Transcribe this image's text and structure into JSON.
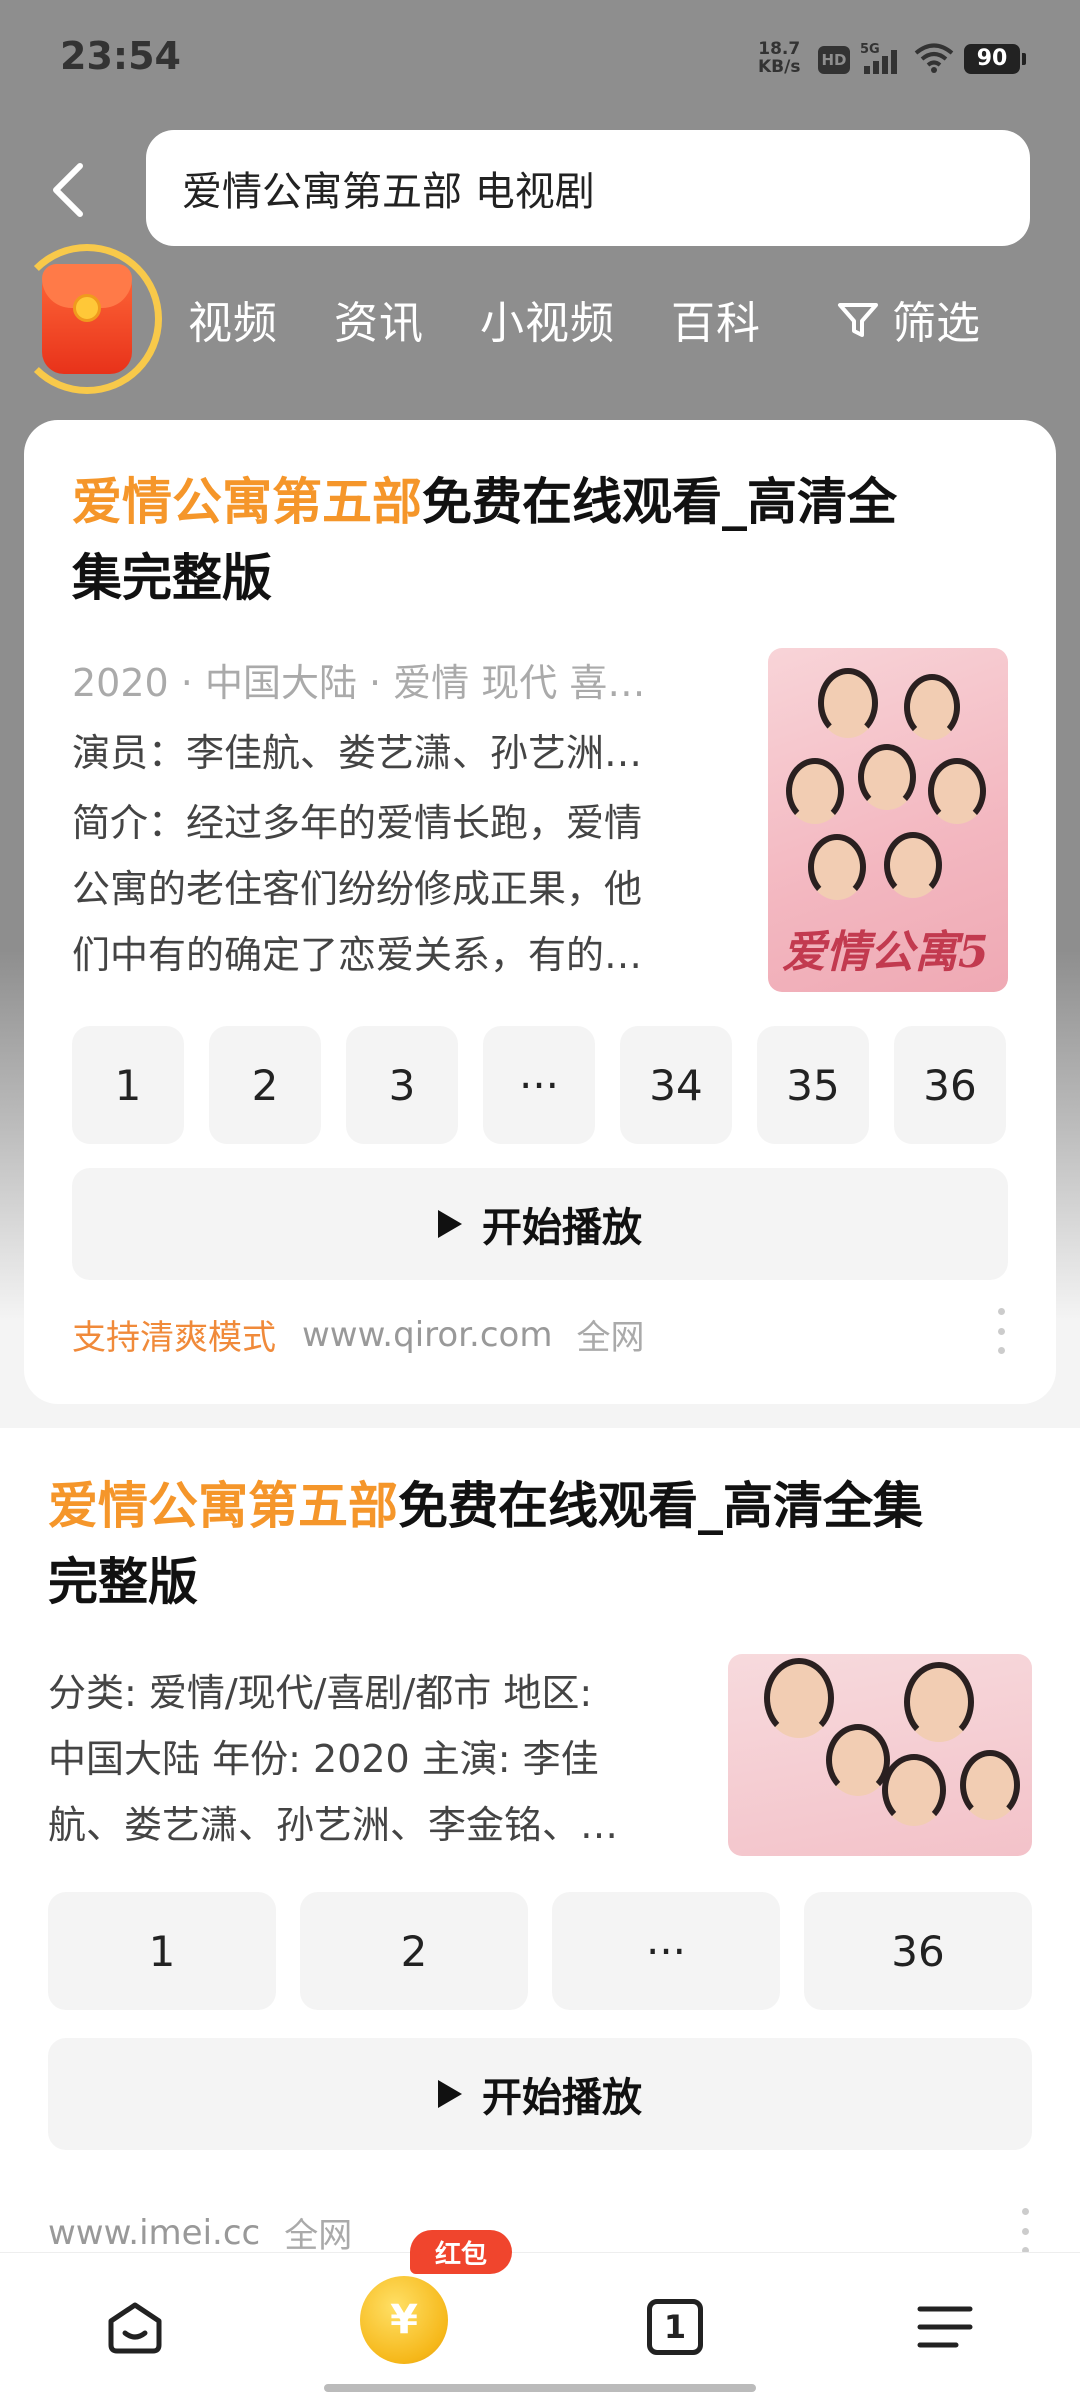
{
  "status_bar": {
    "time": "23:54",
    "net_speed_value": "18.7",
    "net_speed_unit": "KB/s",
    "hd": "HD",
    "signal": "5G",
    "battery": "90"
  },
  "search": {
    "query": "爱情公寓第五部 电视剧"
  },
  "tabs": [
    "视频",
    "资讯",
    "小视频",
    "百科"
  ],
  "filter_label": "筛选",
  "result1": {
    "title_highlight": "爱情公寓第五部",
    "title_rest_line1": "免费在线观看_高清全",
    "title_rest_line2": "集完整版",
    "meta": "2020 · 中国大陆 · 爱情 现代 喜…",
    "actors": "演员：李佳航、娄艺潇、孙艺洲…",
    "intro_line1": "简介：经过多年的爱情长跑，爱情",
    "intro_line2": "公寓的老住客们纷纷修成正果，他",
    "intro_line3": "们中有的确定了恋爱关系，有的…",
    "poster_title": "爱情公寓5",
    "episodes": [
      "1",
      "2",
      "3",
      "···",
      "34",
      "35",
      "36"
    ],
    "play_label": "开始播放",
    "source_mode": "支持清爽模式",
    "source_url": "www.qiror.com",
    "source_scope": "全网"
  },
  "result2": {
    "title_highlight": "爱情公寓第五部",
    "title_rest_line1": "免费在线观看_高清全集",
    "title_rest_line2": "完整版",
    "desc_line1": "分类: 爱情/现代/喜剧/都市 地区:",
    "desc_line2": "中国大陆 年份: 2020 主演: 李佳",
    "desc_line3": "航、娄艺潇、孙艺洲、李金铭、…",
    "episodes": [
      "1",
      "2",
      "···",
      "36"
    ],
    "play_label": "开始播放",
    "source_url": "www.imei.cc",
    "source_scope": "全网"
  },
  "bottom_nav": {
    "coin_symbol": "¥",
    "coin_badge": "红包",
    "tab_count": "1"
  }
}
